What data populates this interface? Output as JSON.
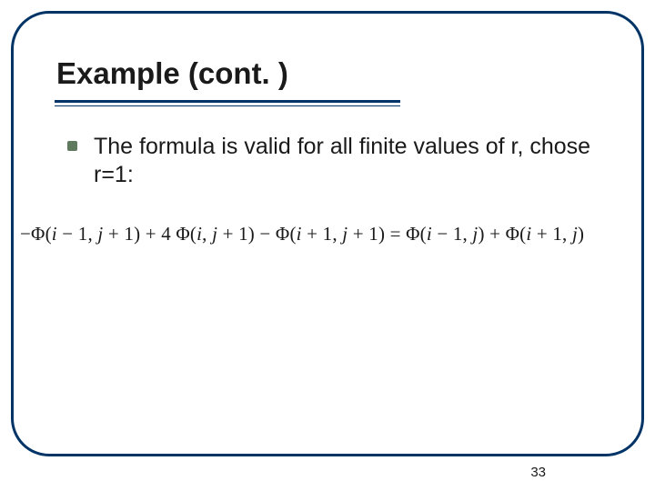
{
  "slide": {
    "title": "Example (cont. )",
    "bullet_text": "The formula is valid for all finite values of r, chose r=1:",
    "equation": "−Φ(i − 1, j + 1) + 4 Φ(i, j + 1) − Φ(i + 1, j + 1) = Φ(i − 1, j) + Φ(i + 1, j)",
    "page_number": "33"
  }
}
